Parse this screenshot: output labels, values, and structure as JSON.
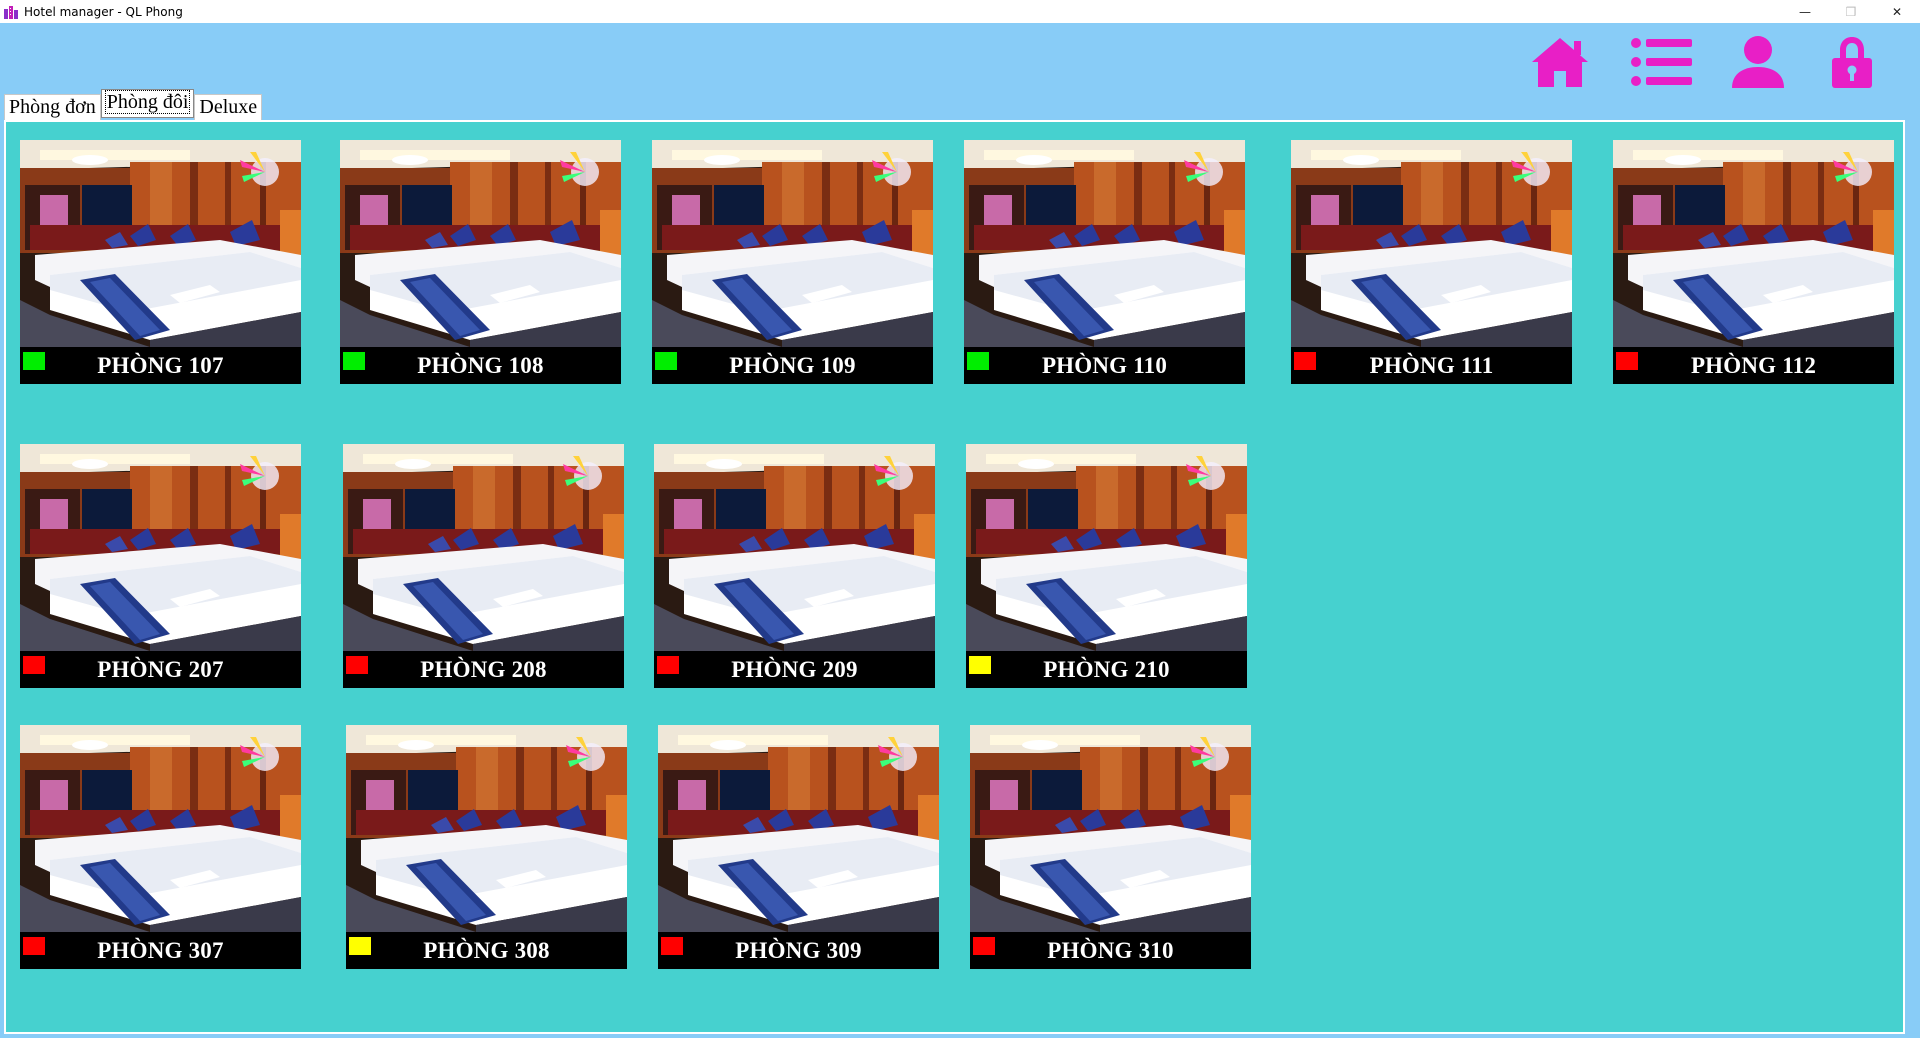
{
  "window": {
    "title": "Hotel manager - QL Phong",
    "minimize": "—",
    "maximize": "❒",
    "close": "✕"
  },
  "header": {
    "icons": [
      "home-icon",
      "list-icon",
      "user-icon",
      "lock-icon"
    ],
    "icon_color": "#E81FC6"
  },
  "tabs": [
    {
      "label": "Phòng đơn",
      "selected": false
    },
    {
      "label": "Phòng đôi",
      "selected": true
    },
    {
      "label": "Deluxe",
      "selected": false
    }
  ],
  "status_colors": {
    "available": "#00EE00",
    "occupied": "#FF0000",
    "pending": "#FFFF00"
  },
  "rooms": [
    {
      "name": "PHÒNG 107",
      "status": "available"
    },
    {
      "name": "PHÒNG 108",
      "status": "available"
    },
    {
      "name": "PHÒNG 109",
      "status": "available"
    },
    {
      "name": "PHÒNG 110",
      "status": "available"
    },
    {
      "name": "PHÒNG 111",
      "status": "occupied"
    },
    {
      "name": "PHÒNG 112",
      "status": "occupied"
    },
    {
      "name": "PHÒNG 207",
      "status": "occupied"
    },
    {
      "name": "PHÒNG 208",
      "status": "occupied"
    },
    {
      "name": "PHÒNG 209",
      "status": "occupied"
    },
    {
      "name": "PHÒNG 210",
      "status": "pending"
    },
    {
      "name": "PHÒNG 307",
      "status": "occupied"
    },
    {
      "name": "PHÒNG 308",
      "status": "pending"
    },
    {
      "name": "PHÒNG 309",
      "status": "occupied"
    },
    {
      "name": "PHÒNG 310",
      "status": "occupied"
    }
  ]
}
